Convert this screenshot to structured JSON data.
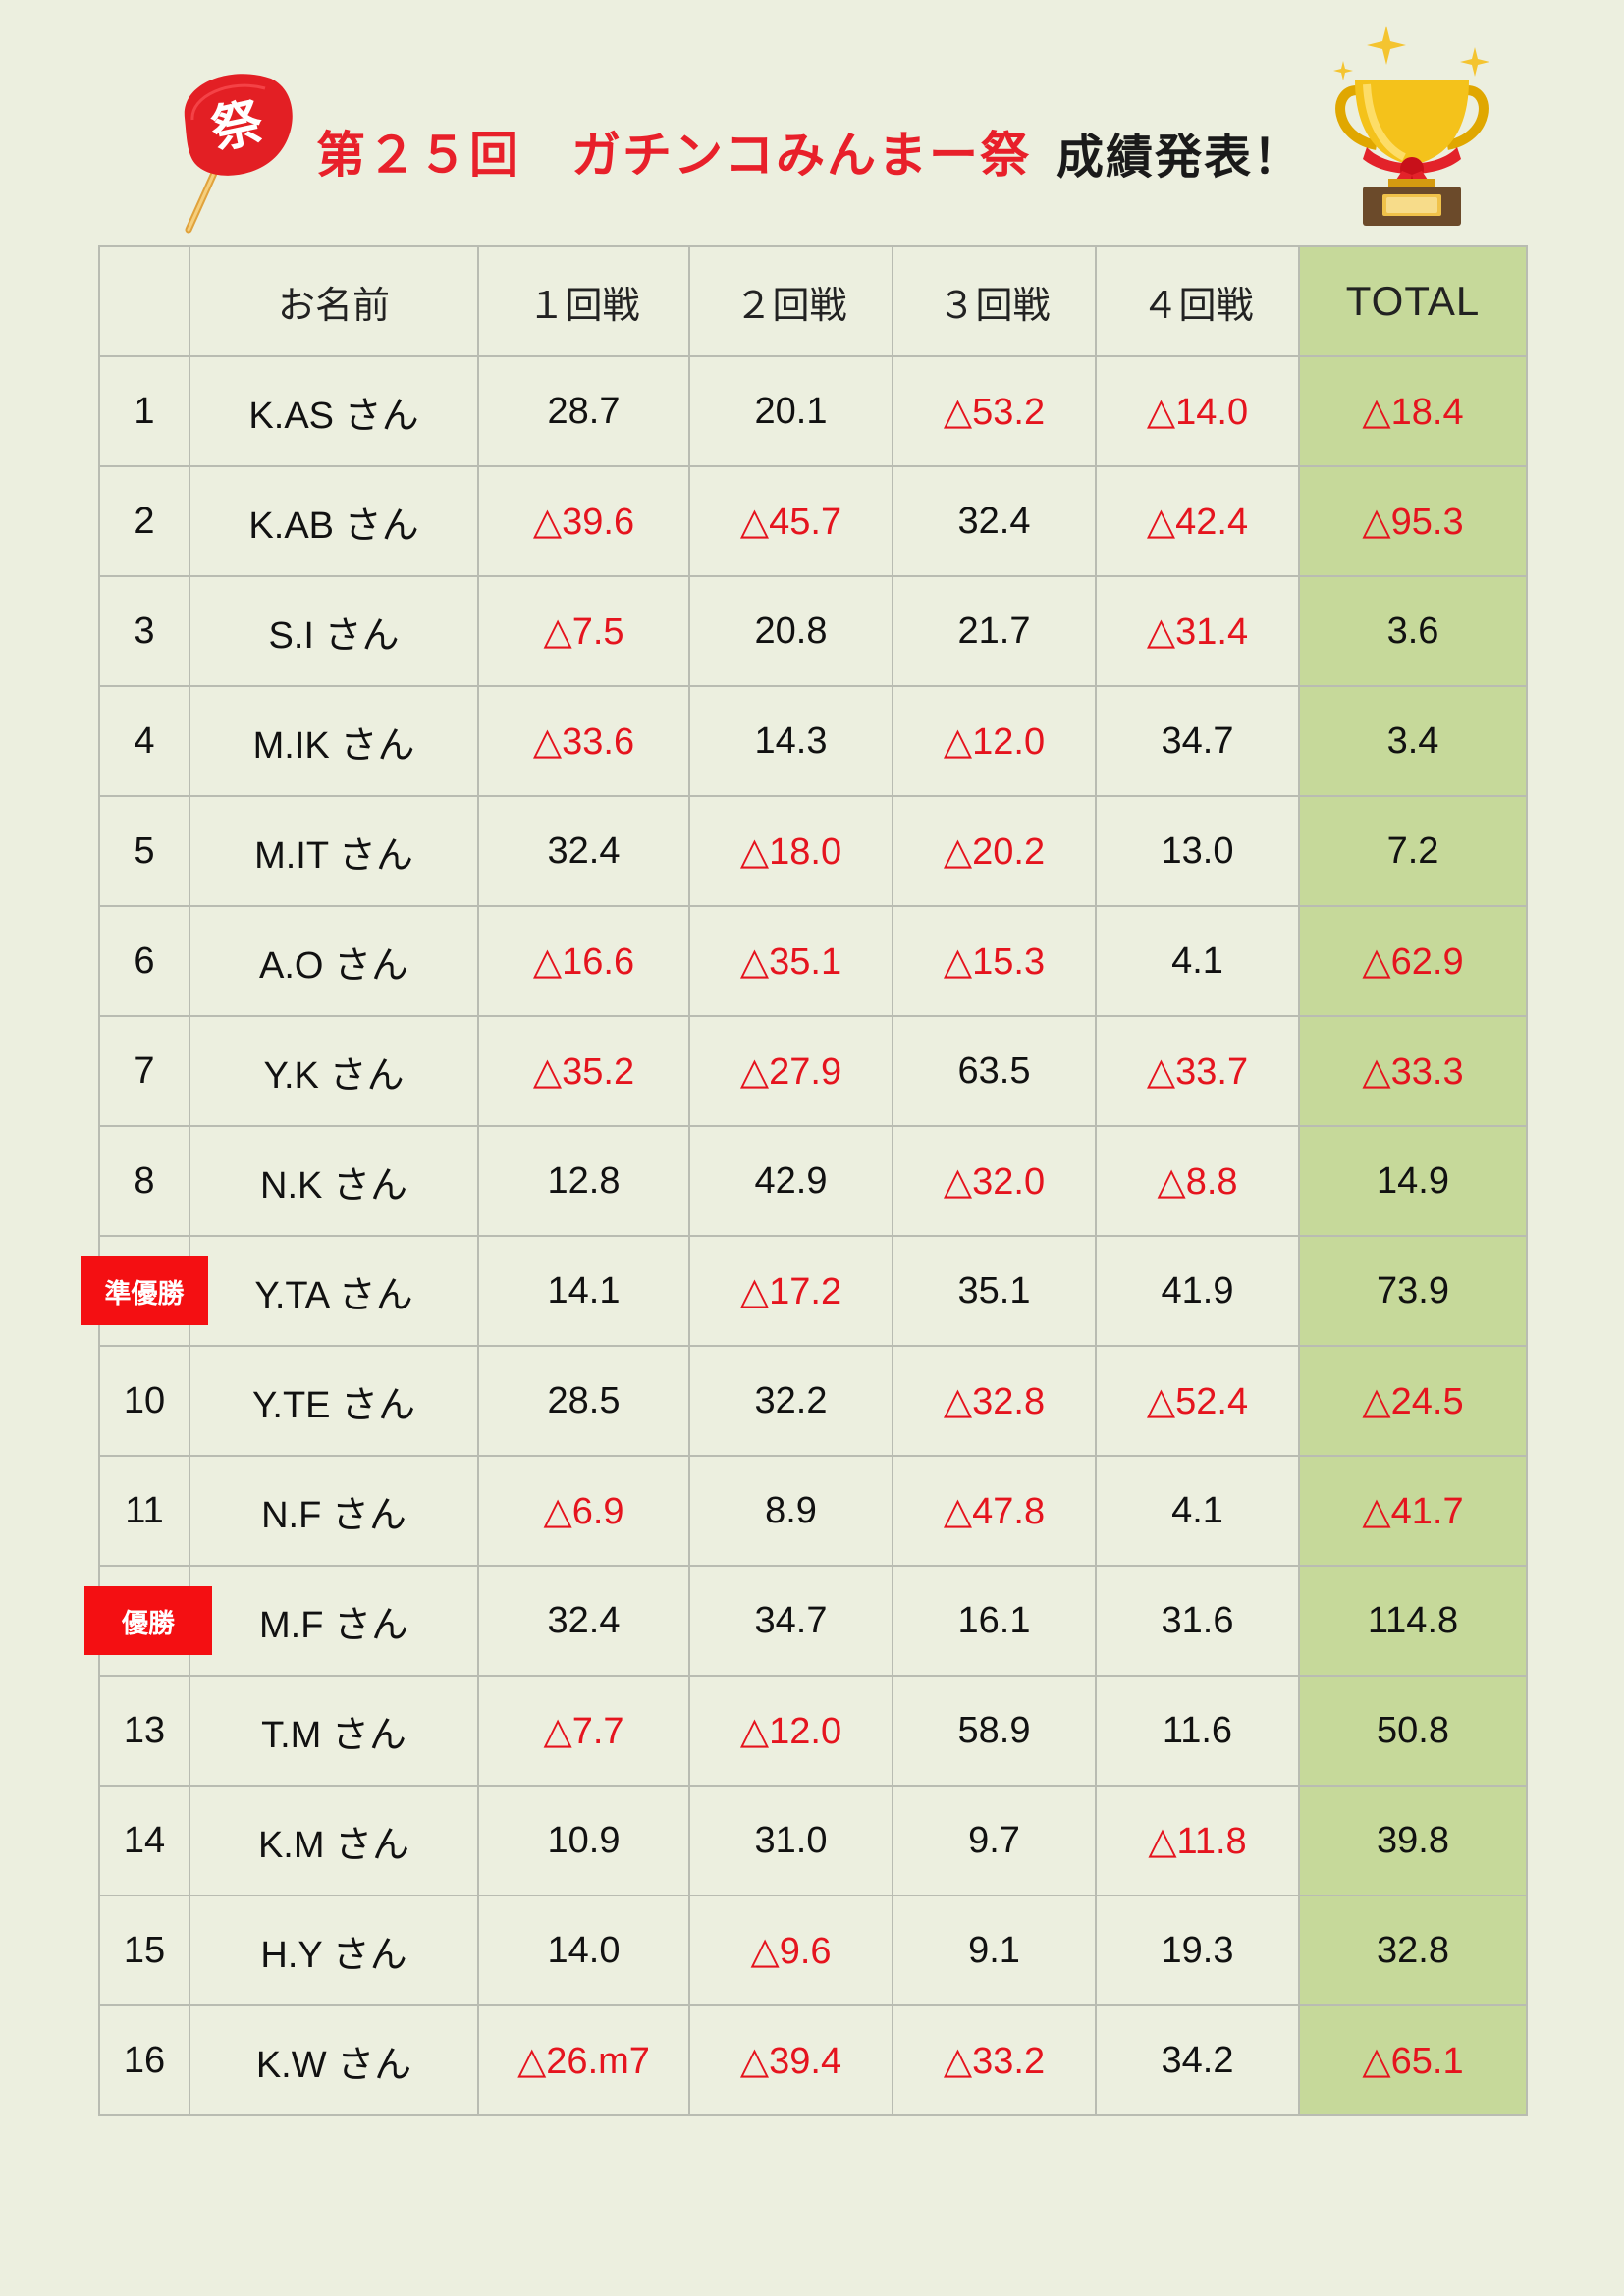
{
  "header": {
    "title": "第２５回　ガチンコみんまー祭",
    "subtitle": "成績発表！",
    "fan_glyph": "祭",
    "fan_icon": "uchiwa-fan-icon",
    "trophy_icon": "trophy-icon"
  },
  "table": {
    "columns": [
      "",
      "お名前",
      "１回戦",
      "２回戦",
      "３回戦",
      "４回戦",
      "TOTAL"
    ],
    "rows": [
      {
        "rank": "1",
        "name": "K.AS さん",
        "scores": [
          "28.7",
          "20.1",
          "△53.2",
          "△14.0"
        ],
        "total": "△18.4"
      },
      {
        "rank": "2",
        "name": "K.AB さん",
        "scores": [
          "△39.6",
          "△45.7",
          "32.4",
          "△42.4"
        ],
        "total": "△95.3"
      },
      {
        "rank": "3",
        "name": "S.I さん",
        "scores": [
          "△7.5",
          "20.8",
          "21.7",
          "△31.4"
        ],
        "total": "3.6"
      },
      {
        "rank": "4",
        "name": "M.IK さん",
        "scores": [
          "△33.6",
          "14.3",
          "△12.0",
          "34.7"
        ],
        "total": "3.4"
      },
      {
        "rank": "5",
        "name": "M.IT さん",
        "scores": [
          "32.4",
          "△18.0",
          "△20.2",
          "13.0"
        ],
        "total": "7.2"
      },
      {
        "rank": "6",
        "name": "A.O さん",
        "scores": [
          "△16.6",
          "△35.1",
          "△15.3",
          "4.1"
        ],
        "total": "△62.9"
      },
      {
        "rank": "7",
        "name": "Y.K さん",
        "scores": [
          "△35.2",
          "△27.9",
          "63.5",
          "△33.7"
        ],
        "total": "△33.3"
      },
      {
        "rank": "8",
        "name": "N.K さん",
        "scores": [
          "12.8",
          "42.9",
          "△32.0",
          "△8.8"
        ],
        "total": "14.9"
      },
      {
        "rank": "",
        "award": "準優勝",
        "name": "Y.TA さん",
        "scores": [
          "14.1",
          "△17.2",
          "35.1",
          "41.9"
        ],
        "total": "73.9"
      },
      {
        "rank": "10",
        "name": "Y.TE さん",
        "scores": [
          "28.5",
          "32.2",
          "△32.8",
          "△52.4"
        ],
        "total": "△24.5"
      },
      {
        "rank": "11",
        "name": "N.F さん",
        "scores": [
          "△6.9",
          "8.9",
          "△47.8",
          "4.1"
        ],
        "total": "△41.7"
      },
      {
        "rank": "",
        "award": "優勝",
        "name": "M.F さん",
        "scores": [
          "32.4",
          "34.7",
          "16.1",
          "31.6"
        ],
        "total": "114.8"
      },
      {
        "rank": "13",
        "name": "T.M さん",
        "scores": [
          "△7.7",
          "△12.0",
          "58.9",
          "11.6"
        ],
        "total": "50.8"
      },
      {
        "rank": "14",
        "name": "K.M さん",
        "scores": [
          "10.9",
          "31.0",
          "9.7",
          "△11.8"
        ],
        "total": "39.8"
      },
      {
        "rank": "15",
        "name": "H.Y さん",
        "scores": [
          "14.0",
          "△9.6",
          "9.1",
          "19.3"
        ],
        "total": "32.8"
      },
      {
        "rank": "16",
        "name": "K.W さん",
        "scores": [
          "△26.m7",
          "△39.4",
          "△33.2",
          "34.2"
        ],
        "total": "△65.1"
      }
    ]
  },
  "colors": {
    "background": "#ecefdf",
    "title_red": "#e8202a",
    "negative_red": "#e5141e",
    "total_column": "#c6d99a",
    "award_badge": "#f40f12",
    "grid": "#b9bcb2"
  }
}
